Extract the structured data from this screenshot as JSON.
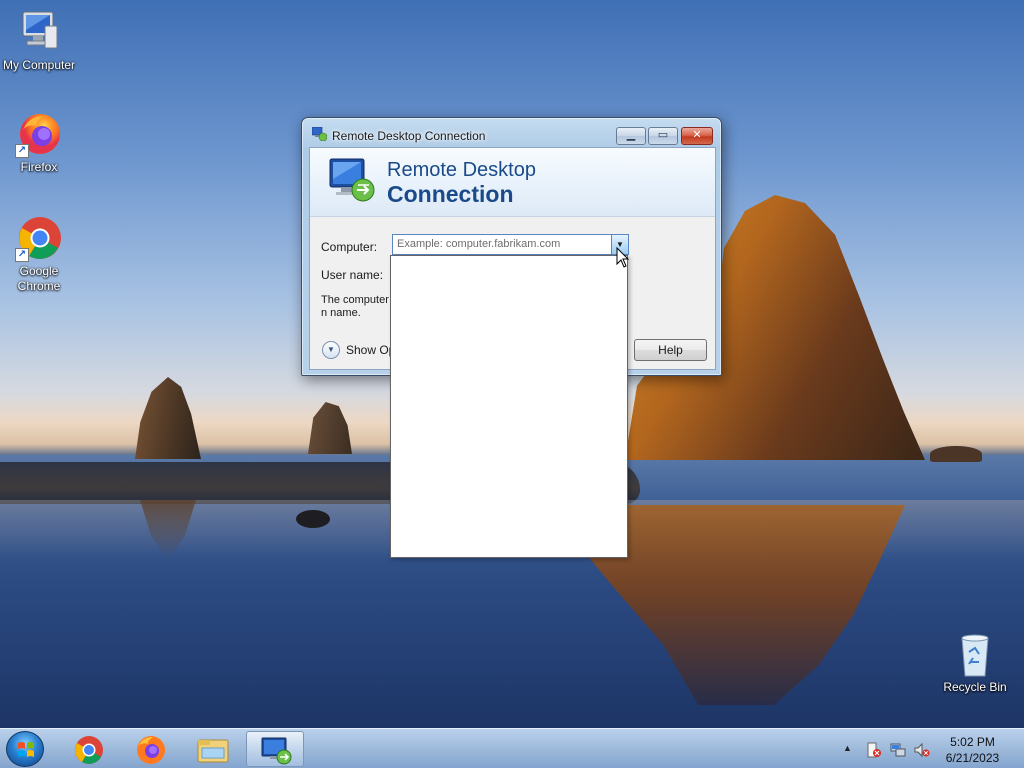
{
  "desktop": {
    "icons": [
      {
        "label": "My Computer",
        "icon": "computer-icon"
      },
      {
        "label": "Firefox",
        "icon": "firefox-icon"
      },
      {
        "label": "Google Chrome",
        "icon": "chrome-icon"
      },
      {
        "label": "Recycle Bin",
        "icon": "recycle-bin-icon"
      }
    ]
  },
  "dialog": {
    "title": "Remote Desktop Connection",
    "banner_line1": "Remote Desktop",
    "banner_line2": "Connection",
    "computer_label": "Computer:",
    "computer_placeholder": "Example: computer.fabrikam.com",
    "username_label": "User name:",
    "info_text": "The computer n name.",
    "show_options_label": "Show Opt",
    "help_label": "Help",
    "caption_buttons": {
      "minimize": "minimize-icon",
      "maximize": "maximize-icon",
      "close": "close-icon"
    }
  },
  "taskbar": {
    "pinned": [
      "start-orb-icon",
      "chrome-icon",
      "firefox-icon",
      "file-explorer-icon",
      "remote-desktop-icon"
    ],
    "active_app": "Remote Desktop Connection",
    "tray_icons": [
      "show-hidden-icons",
      "action-center-icon",
      "network-icon",
      "volume-muted-icon"
    ],
    "time": "5:02 PM",
    "date": "6/21/2023"
  },
  "colors": {
    "banner_text": "#1a4a8a",
    "combo_border": "#5b86c0",
    "close_button": "#c33a20"
  }
}
